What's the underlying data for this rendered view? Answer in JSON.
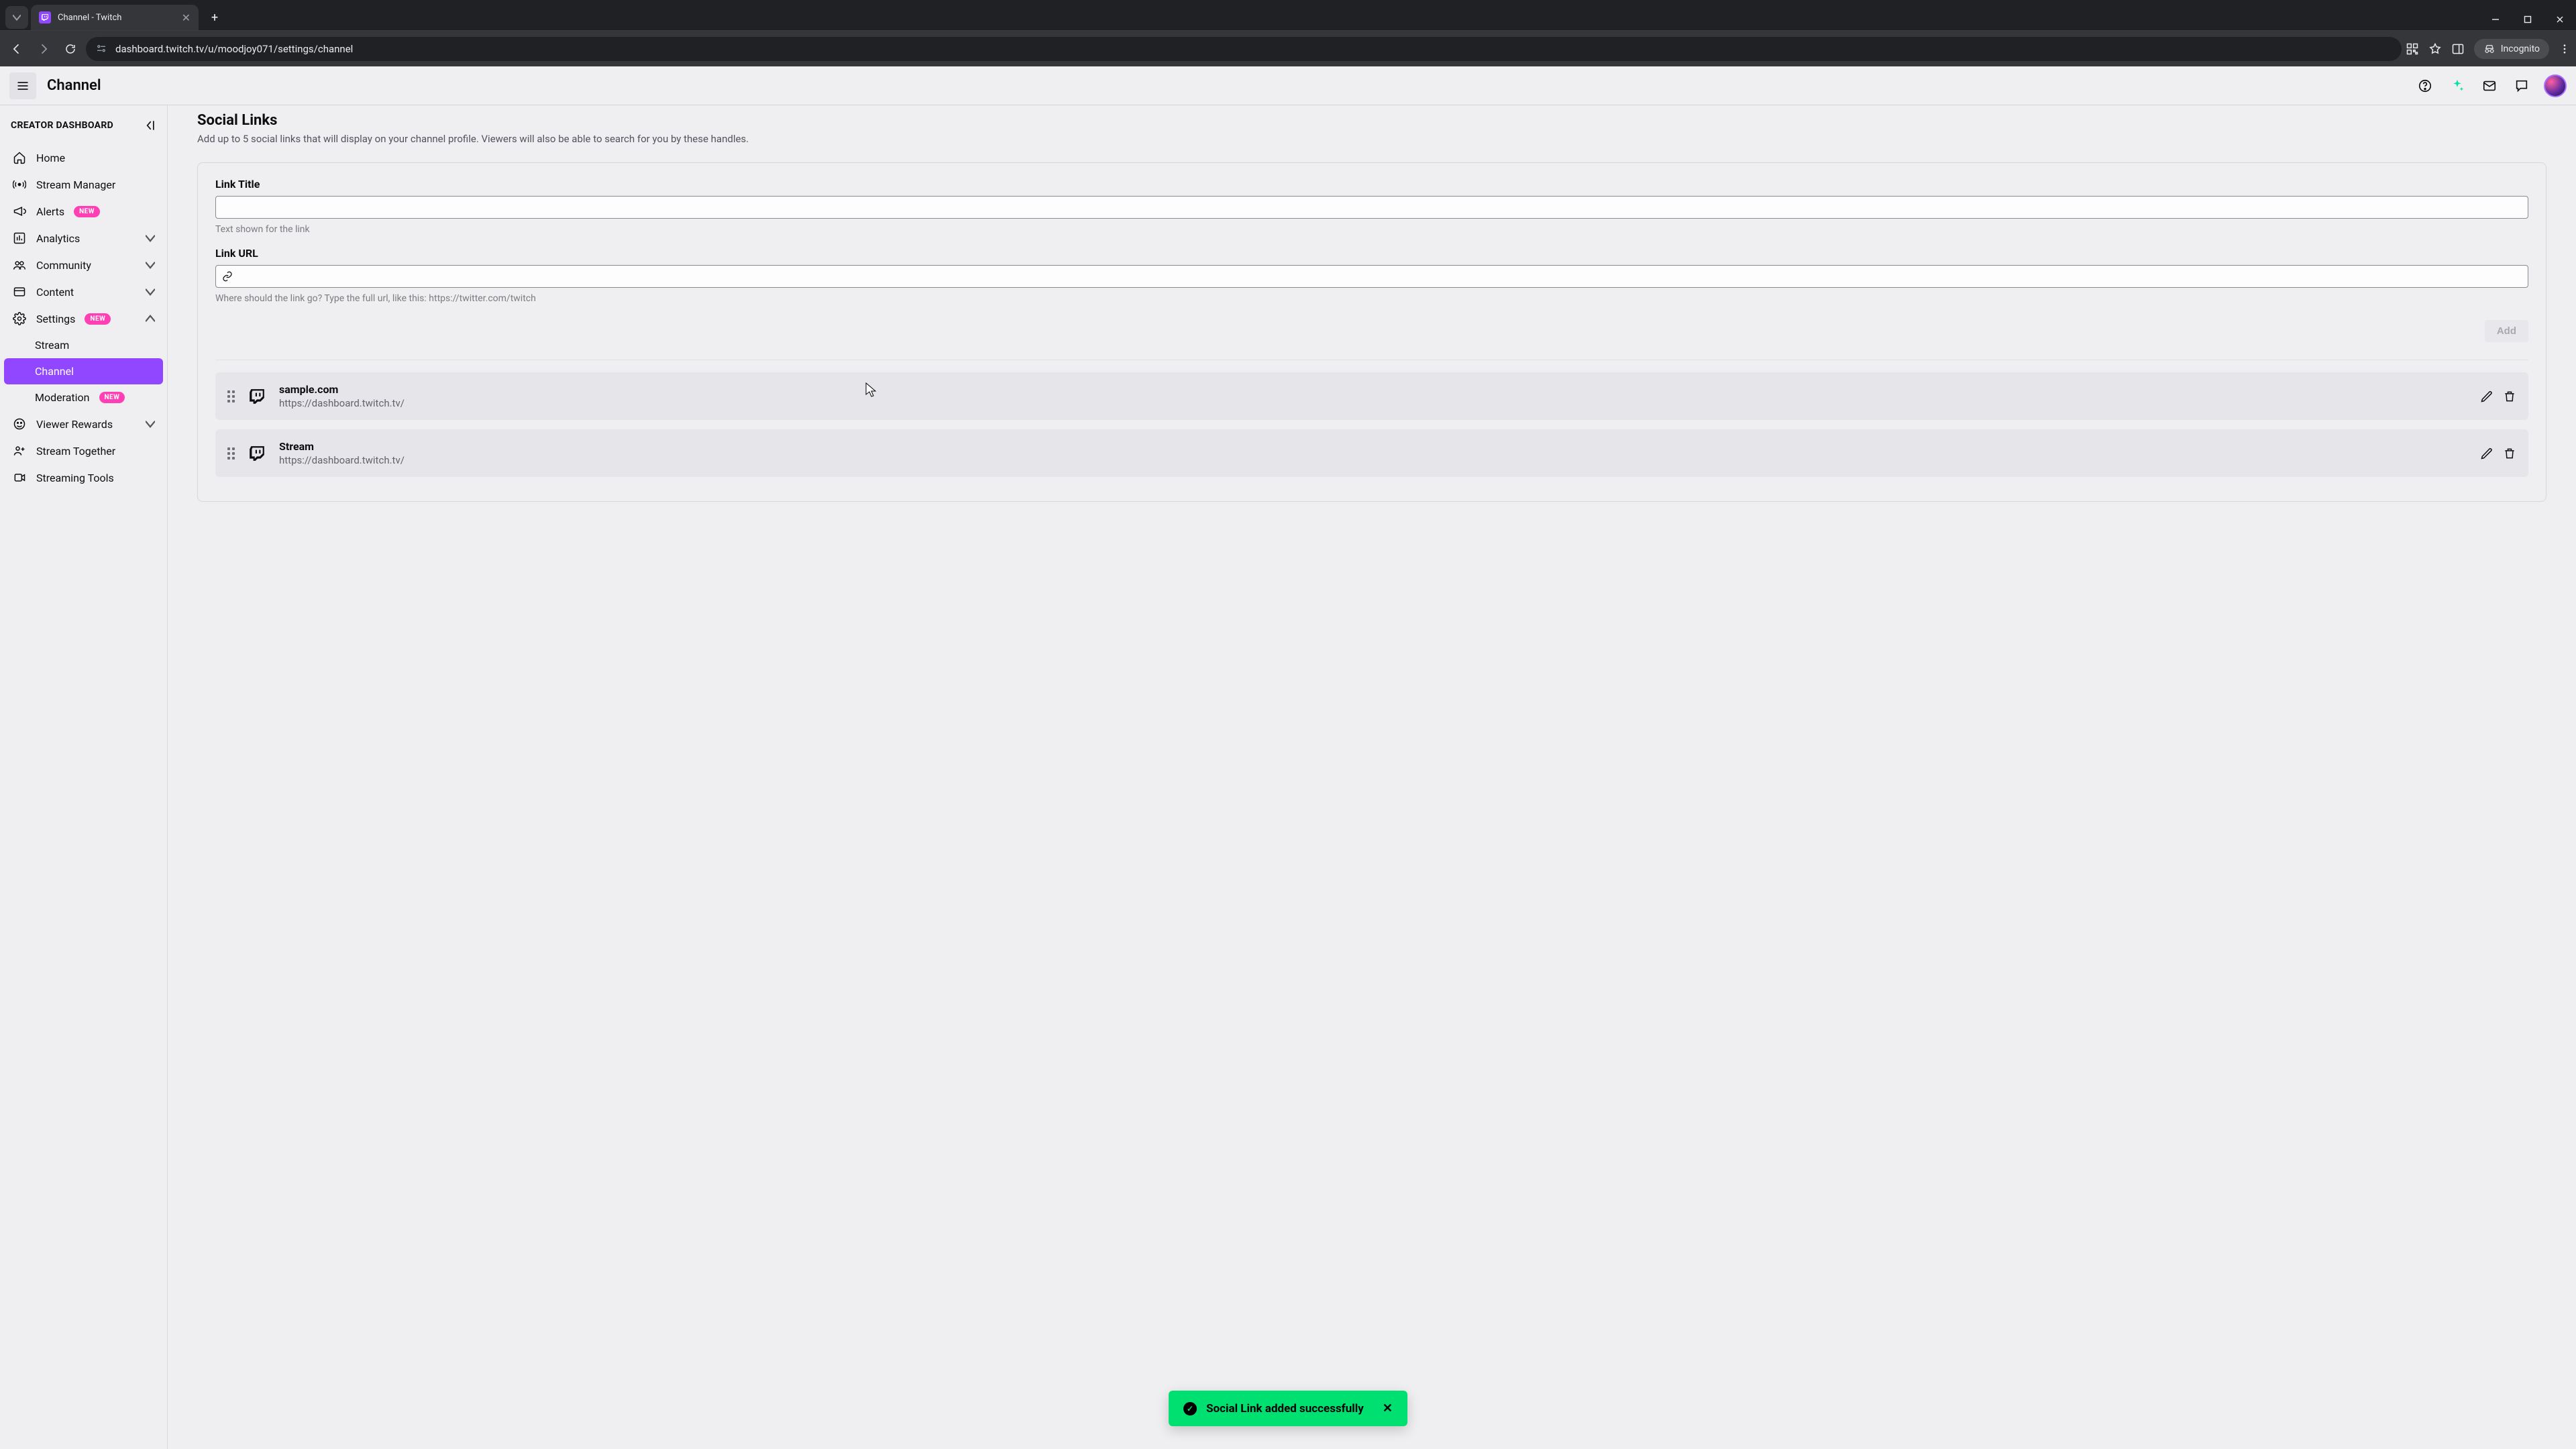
{
  "browser": {
    "tab_title": "Channel - Twitch",
    "url": "dashboard.twitch.tv/u/moodjoy071/settings/channel",
    "incognito_label": "Incognito"
  },
  "header": {
    "title": "Channel"
  },
  "sidebar": {
    "heading": "CREATOR DASHBOARD",
    "new_badge": "NEW",
    "items": {
      "home": "Home",
      "stream_manager": "Stream Manager",
      "alerts": "Alerts",
      "analytics": "Analytics",
      "community": "Community",
      "content": "Content",
      "settings": "Settings",
      "stream": "Stream",
      "channel": "Channel",
      "moderation": "Moderation",
      "viewer_rewards": "Viewer Rewards",
      "stream_together": "Stream Together",
      "streaming_tools": "Streaming Tools"
    }
  },
  "social_links": {
    "title": "Social Links",
    "description": "Add up to 5 social links that will display on your channel profile. Viewers will also be able to search for you by these handles.",
    "link_title_label": "Link Title",
    "link_title_help": "Text shown for the link",
    "link_url_label": "Link URL",
    "link_url_help": "Where should the link go? Type the full url, like this: https://twitter.com/twitch",
    "add_button": "Add",
    "links": [
      {
        "title": "sample.com",
        "url": "https://dashboard.twitch.tv/"
      },
      {
        "title": "Stream",
        "url": "https://dashboard.twitch.tv/"
      }
    ]
  },
  "toast": {
    "message": "Social Link added successfully"
  }
}
